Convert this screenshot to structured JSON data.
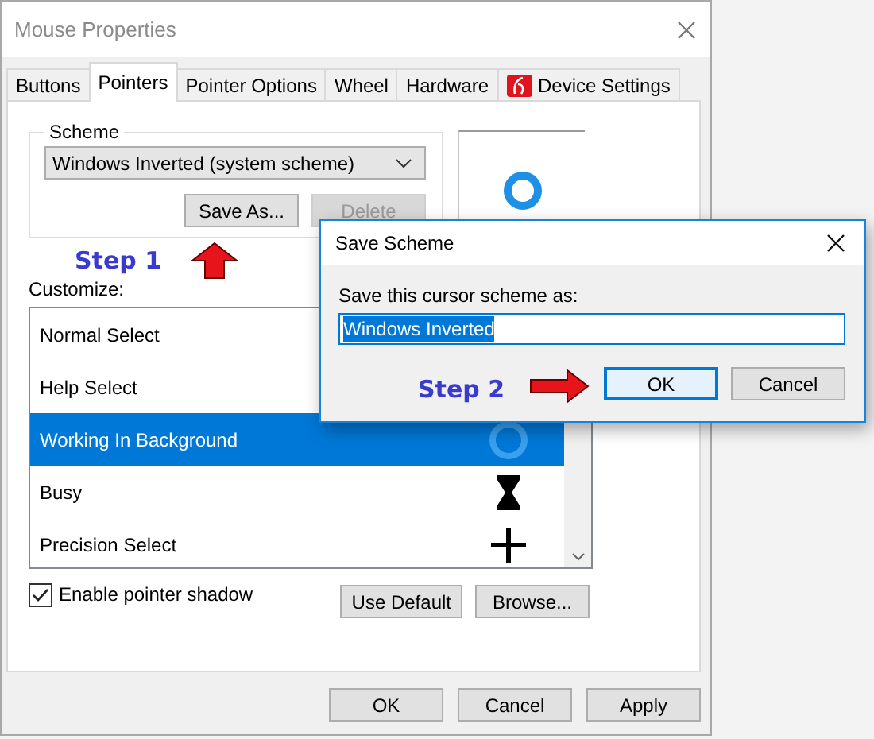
{
  "window": {
    "title": "Mouse Properties"
  },
  "tabs": [
    {
      "label": "Buttons",
      "selected": false,
      "kind": "text"
    },
    {
      "label": "Pointers",
      "selected": true,
      "kind": "text"
    },
    {
      "label": "Pointer Options",
      "selected": false,
      "kind": "text"
    },
    {
      "label": "Wheel",
      "selected": false,
      "kind": "text"
    },
    {
      "label": "Hardware",
      "selected": false,
      "kind": "text"
    },
    {
      "label": "Device Settings",
      "selected": false,
      "kind": "icon"
    }
  ],
  "scheme": {
    "label": "Scheme",
    "value": "Windows Inverted (system scheme)",
    "buttons": [
      {
        "label": "Save As...",
        "disabled": false
      },
      {
        "label": "Delete",
        "disabled": true
      }
    ]
  },
  "customize": {
    "label": "Customize:",
    "rows": [
      {
        "name": "Normal Select",
        "selected": false,
        "kind": "none"
      },
      {
        "name": "Help Select",
        "selected": false,
        "kind": "none"
      },
      {
        "name": "Working In Background",
        "selected": true,
        "kind": "ring"
      },
      {
        "name": "Busy",
        "selected": false,
        "kind": "hourglass"
      },
      {
        "name": "Precision Select",
        "selected": false,
        "kind": "cross"
      }
    ]
  },
  "shadow": {
    "label": "Enable pointer shadow",
    "checked": true
  },
  "pointer_buttons": [
    "Use Default",
    "Browse..."
  ],
  "buttons": [
    "OK",
    "Cancel",
    "Apply"
  ],
  "dialog": {
    "title": "Save Scheme",
    "prompt": "Save this cursor scheme as:",
    "value": "Windows Inverted",
    "value_selected": true,
    "buttons": [
      {
        "label": "OK",
        "default": true
      },
      {
        "label": "Cancel",
        "default": false
      }
    ]
  },
  "annotations": [
    {
      "text": "Step 1"
    },
    {
      "text": "Step 2"
    }
  ]
}
